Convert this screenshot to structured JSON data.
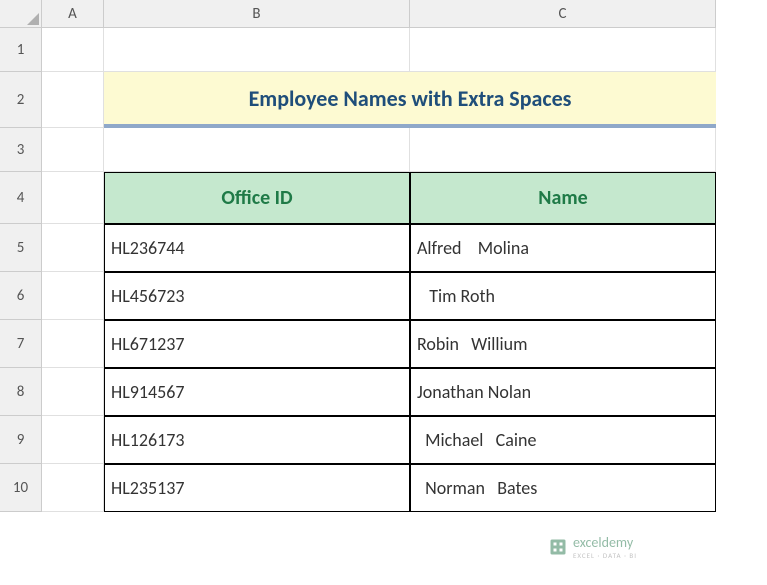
{
  "columns": [
    "A",
    "B",
    "C"
  ],
  "rows": [
    "1",
    "2",
    "3",
    "4",
    "5",
    "6",
    "7",
    "8",
    "9",
    "10"
  ],
  "title": "Employee Names with Extra Spaces",
  "headers": {
    "id": "Office ID",
    "name": "Name"
  },
  "data": [
    {
      "id": "HL236744",
      "name": "Alfred    Molina"
    },
    {
      "id": "HL456723",
      "name": "   Tim Roth"
    },
    {
      "id": "HL671237",
      "name": "Robin   Willium"
    },
    {
      "id": "HL914567",
      "name": "Jonathan Nolan"
    },
    {
      "id": "HL126173",
      "name": "  Michael   Caine"
    },
    {
      "id": "HL235137",
      "name": "  Norman   Bates"
    }
  ],
  "watermark": {
    "text": "exceldemy",
    "sub": "EXCEL · DATA · BI"
  },
  "chart_data": {
    "type": "table",
    "title": "Employee Names with Extra Spaces",
    "columns": [
      "Office ID",
      "Name"
    ],
    "rows": [
      [
        "HL236744",
        "Alfred    Molina"
      ],
      [
        "HL456723",
        "   Tim Roth"
      ],
      [
        "HL671237",
        "Robin   Willium"
      ],
      [
        "HL914567",
        "Jonathan Nolan"
      ],
      [
        "HL126173",
        "  Michael   Caine"
      ],
      [
        "HL235137",
        "  Norman   Bates"
      ]
    ]
  }
}
